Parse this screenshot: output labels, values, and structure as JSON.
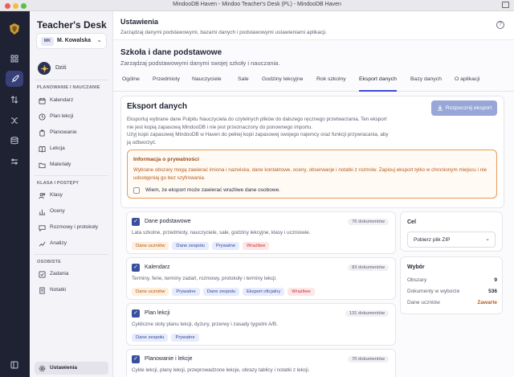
{
  "window": {
    "title": "MindooDB Haven - Mindoo Teacher's Desk (PL) - MindooDB Haven"
  },
  "sidebar": {
    "app_name": "Teacher's Desk",
    "user_initials": "MK",
    "user_name": "M. Kowalska",
    "today_label": "Dziś",
    "section_planning": "PLANOWANIE I NAUCZANIE",
    "section_classes": "KLASA I POSTĘPY",
    "section_personal": "OSOBISTE",
    "items": [
      {
        "label": "Kalendarz"
      },
      {
        "label": "Plan lekcji"
      },
      {
        "label": "Planowanie"
      },
      {
        "label": "Lekcja"
      },
      {
        "label": "Materiały"
      },
      {
        "label": "Klasy"
      },
      {
        "label": "Oceny"
      },
      {
        "label": "Rozmowy i protokoły"
      },
      {
        "label": "Analizy"
      },
      {
        "label": "Zadania"
      },
      {
        "label": "Notatki"
      },
      {
        "label": "Ustawienia"
      }
    ]
  },
  "header": {
    "title": "Ustawienia",
    "subtitle": "Zarządzaj danymi podstawowymi, bazami danych i podstawowymi ustawieniami aplikacji."
  },
  "section": {
    "title": "Szkoła i dane podstawowe",
    "subtitle": "Zarządzaj podstawowymi danymi swojej szkoły i nauczania."
  },
  "tabs": [
    {
      "label": "Ogólne"
    },
    {
      "label": "Przedmioty"
    },
    {
      "label": "Nauczyciele"
    },
    {
      "label": "Sale"
    },
    {
      "label": "Godziny lekcyjne"
    },
    {
      "label": "Rok szkolny"
    },
    {
      "label": "Eksport danych"
    },
    {
      "label": "Bazy danych"
    },
    {
      "label": "O aplikacji"
    }
  ],
  "export": {
    "title": "Eksport danych",
    "desc1": "Eksportuj wybrane dane Pulpitu Nauczyciela do czytelnych plików do dalszego ręcznego przetwarzania. Ten eksport nie jest kopią zapasową MindooDB i nie jest przeznaczony do ponownego importu.",
    "desc2": "Użyj kopii zapasowej MindooDB w Haven do pełnej kopii zapasowej swojego najemcy oraz funkcji przywracania, aby ją odtworzyć.",
    "start_button": "Rozpocznij eksport",
    "privacy_title": "Informacja o prywatności",
    "privacy_text": "Wybrane obszary mogą zawierać imiona i nazwiska, dane kontaktowe, oceny, obserwacje i notatki z rozmów. Zapisuj eksport tylko w chronionym miejscu i nie udostępniaj go bez szyfrowania.",
    "consent_label": "Wiem, że eksport może zawierać wrażliwe dane osobowe."
  },
  "items": [
    {
      "title": "Dane podstawowe",
      "count": "76 dokumentów",
      "desc": "Lata szkolne, przedmioty, nauczyciele, sale, godziny lekcyjne, klasy i uczniowie.",
      "tags": [
        {
          "text": "Dane uczniów",
          "c": "orange"
        },
        {
          "text": "Dane zespołu",
          "c": "blue"
        },
        {
          "text": "Prywatne",
          "c": "blue"
        },
        {
          "text": "Wrażliwe",
          "c": "red"
        }
      ]
    },
    {
      "title": "Kalendarz",
      "count": "83 dokumentów",
      "desc": "Terminy, ferie, terminy zadań, rozmowy, protokoły i terminy lekcji.",
      "tags": [
        {
          "text": "Dane uczniów",
          "c": "orange"
        },
        {
          "text": "Prywatne",
          "c": "blue"
        },
        {
          "text": "Dane zespołu",
          "c": "blue"
        },
        {
          "text": "Eksport oficjalny",
          "c": "blue"
        },
        {
          "text": "Wrażliwe",
          "c": "red"
        }
      ]
    },
    {
      "title": "Plan lekcji",
      "count": "131 dokumentów",
      "desc": "Cykliczne sloty planu lekcji, dyżury, przerwy i zasady tygodni A/B.",
      "tags": [
        {
          "text": "Dane zespołu",
          "c": "blue"
        },
        {
          "text": "Prywatne",
          "c": "blue"
        }
      ]
    },
    {
      "title": "Planowanie i lekcje",
      "count": "70 dokumentów",
      "desc": "Cykle lekcji, plany lekcji, przeprowadzone lekcje, obrazy tablicy i notatki z lekcji.",
      "tags": []
    }
  ],
  "target": {
    "title": "Cel",
    "select_value": "Pobierz plik ZIP"
  },
  "summary": {
    "title": "Wybór",
    "areas_label": "Obszary",
    "areas_value": "9",
    "docs_label": "Dokumenty w wyborze",
    "docs_value": "536",
    "students_label": "Dane uczniów",
    "students_value": "Zawarte"
  },
  "colors": {
    "accent": "#3b4bd8",
    "rail": "#1e2233",
    "warning": "#e79a5a"
  }
}
